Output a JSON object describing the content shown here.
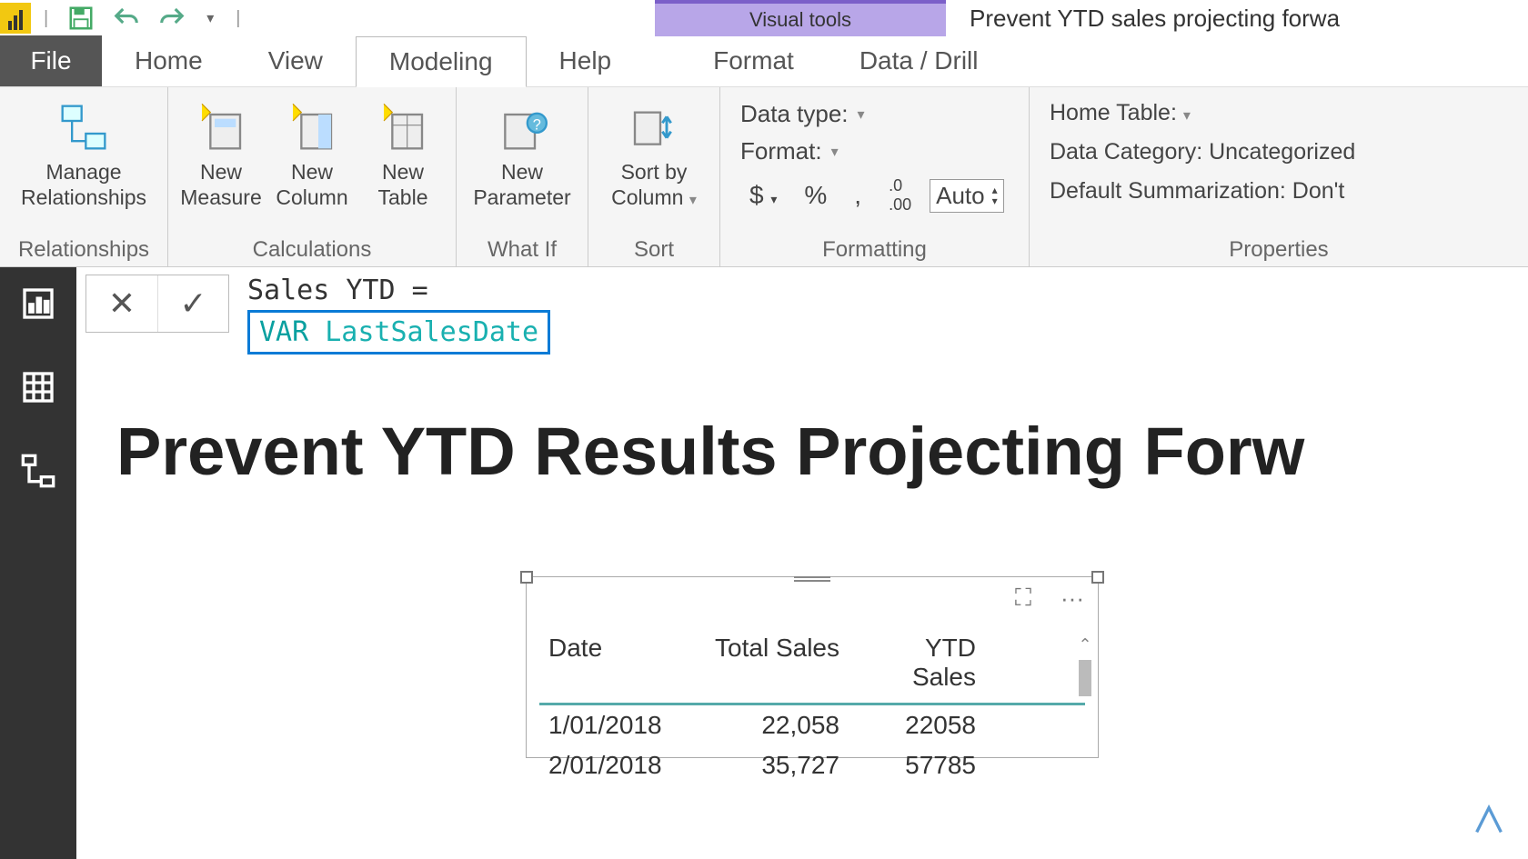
{
  "titlebar": {
    "contextual_tab": "Visual tools",
    "document_title": "Prevent YTD sales projecting forwa"
  },
  "tabs": {
    "file": "File",
    "home": "Home",
    "view": "View",
    "modeling": "Modeling",
    "help": "Help",
    "format": "Format",
    "data_drill": "Data / Drill"
  },
  "ribbon": {
    "relationships_group": "Relationships",
    "manage_relationships": "Manage Relationships",
    "calculations_group": "Calculations",
    "new_measure": "New Measure",
    "new_column": "New Column",
    "new_table": "New Table",
    "whatif_group": "What If",
    "new_parameter": "New Parameter",
    "sort_group": "Sort",
    "sort_by_column": "Sort by Column",
    "formatting_group": "Formatting",
    "data_type": "Data type:",
    "format": "Format:",
    "currency": "$",
    "percent": "%",
    "comma": ",",
    "decimal_icon": ".00",
    "decimals_value": "Auto",
    "properties_group": "Properties",
    "home_table": "Home Table:",
    "data_category": "Data Category: Uncategorized",
    "default_summarization": "Default Summarization: Don't"
  },
  "formula": {
    "line1": "Sales YTD =",
    "var_kw": "VAR",
    "var_name": "LastSalesDate"
  },
  "report": {
    "title": "Prevent YTD Results Projecting Forw"
  },
  "table": {
    "headers": {
      "date": "Date",
      "total": "Total Sales",
      "ytd": "YTD Sales"
    },
    "rows": [
      {
        "date": "1/01/2018",
        "total": "22,058",
        "ytd": "22058"
      },
      {
        "date": "2/01/2018",
        "total": "35,727",
        "ytd": "57785"
      }
    ]
  },
  "icons": {
    "focus": "⛶",
    "more": "···",
    "caret": "▾",
    "up": "▴",
    "down": "▾"
  }
}
